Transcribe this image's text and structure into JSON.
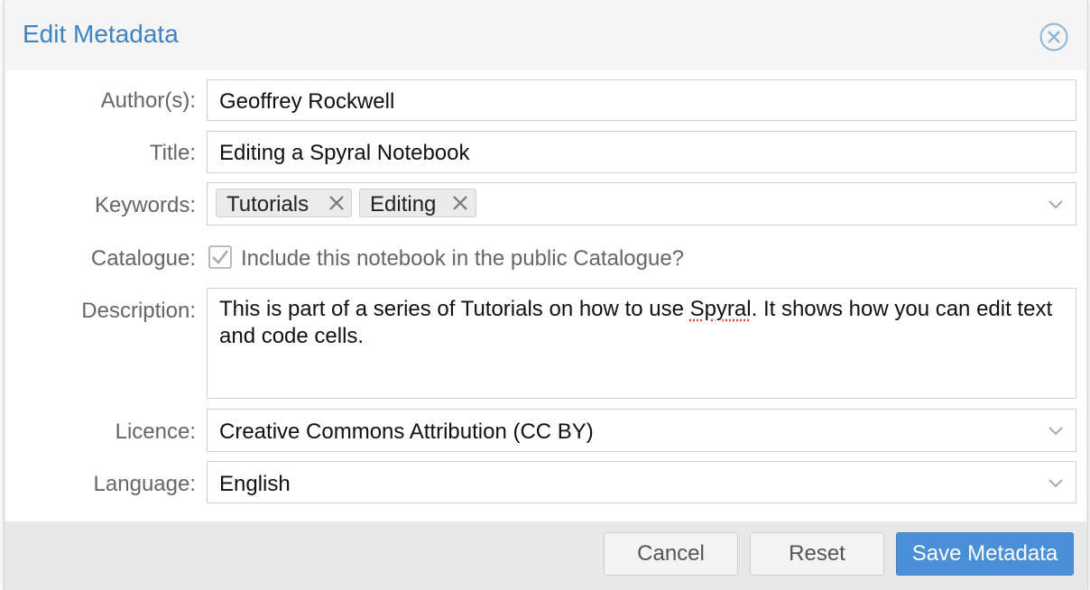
{
  "dialog": {
    "title": "Edit Metadata",
    "close_icon": "close-circle-icon"
  },
  "form": {
    "authors": {
      "label": "Author(s):",
      "value": "Geoffrey Rockwell"
    },
    "title": {
      "label": "Title:",
      "value": "Editing a Spyral Notebook"
    },
    "keywords": {
      "label": "Keywords:",
      "tags": [
        "Tutorials",
        "Editing"
      ],
      "remove_icon": "close-icon",
      "dropdown_icon": "chevron-down-icon"
    },
    "catalogue": {
      "label": "Catalogue:",
      "checkbox_label": "Include this notebook in the public Catalogue?",
      "checked": true
    },
    "description": {
      "label": "Description:",
      "value_before": "This is part of a series of Tutorials on how to use ",
      "value_misspelled": "Spyral",
      "value_after": ". It shows how you can edit text and code cells."
    },
    "licence": {
      "label": "Licence:",
      "value": "Creative Commons Attribution (CC BY)",
      "dropdown_icon": "chevron-down-icon"
    },
    "language": {
      "label": "Language:",
      "value": "English",
      "dropdown_icon": "chevron-down-icon"
    }
  },
  "footer": {
    "cancel_label": "Cancel",
    "reset_label": "Reset",
    "save_label": "Save Metadata"
  },
  "colors": {
    "accent": "#3f83c4",
    "primary_button": "#4a90d9",
    "label": "#666666"
  }
}
